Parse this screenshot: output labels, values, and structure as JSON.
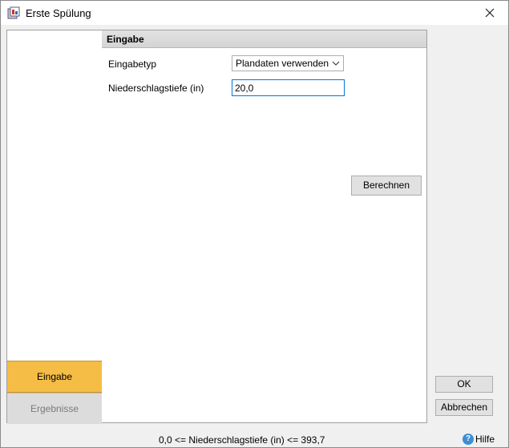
{
  "window": {
    "title": "Erste Spülung"
  },
  "nav": {
    "items": [
      {
        "label": "Eingabe",
        "active": true
      },
      {
        "label": "Ergebnisse",
        "active": false
      }
    ]
  },
  "group": {
    "title": "Eingabe"
  },
  "form": {
    "type_label": "Eingabetyp",
    "type_value": "Plandaten verwenden",
    "depth_label": "Niederschlagstiefe (in)",
    "depth_value": "20,0",
    "calculate_label": "Berechnen"
  },
  "footer": {
    "ok_label": "OK",
    "cancel_label": "Abbrechen",
    "status_text": "0,0 <= Niederschlagstiefe (in) <= 393,7",
    "help_label": "Hilfe"
  },
  "colors": {
    "accent": "#f5bd45",
    "focus": "#0078d7"
  },
  "icons": {
    "app": "app-icon",
    "close": "close-icon",
    "dropdown": "chevron-down-icon",
    "help": "help-icon"
  }
}
